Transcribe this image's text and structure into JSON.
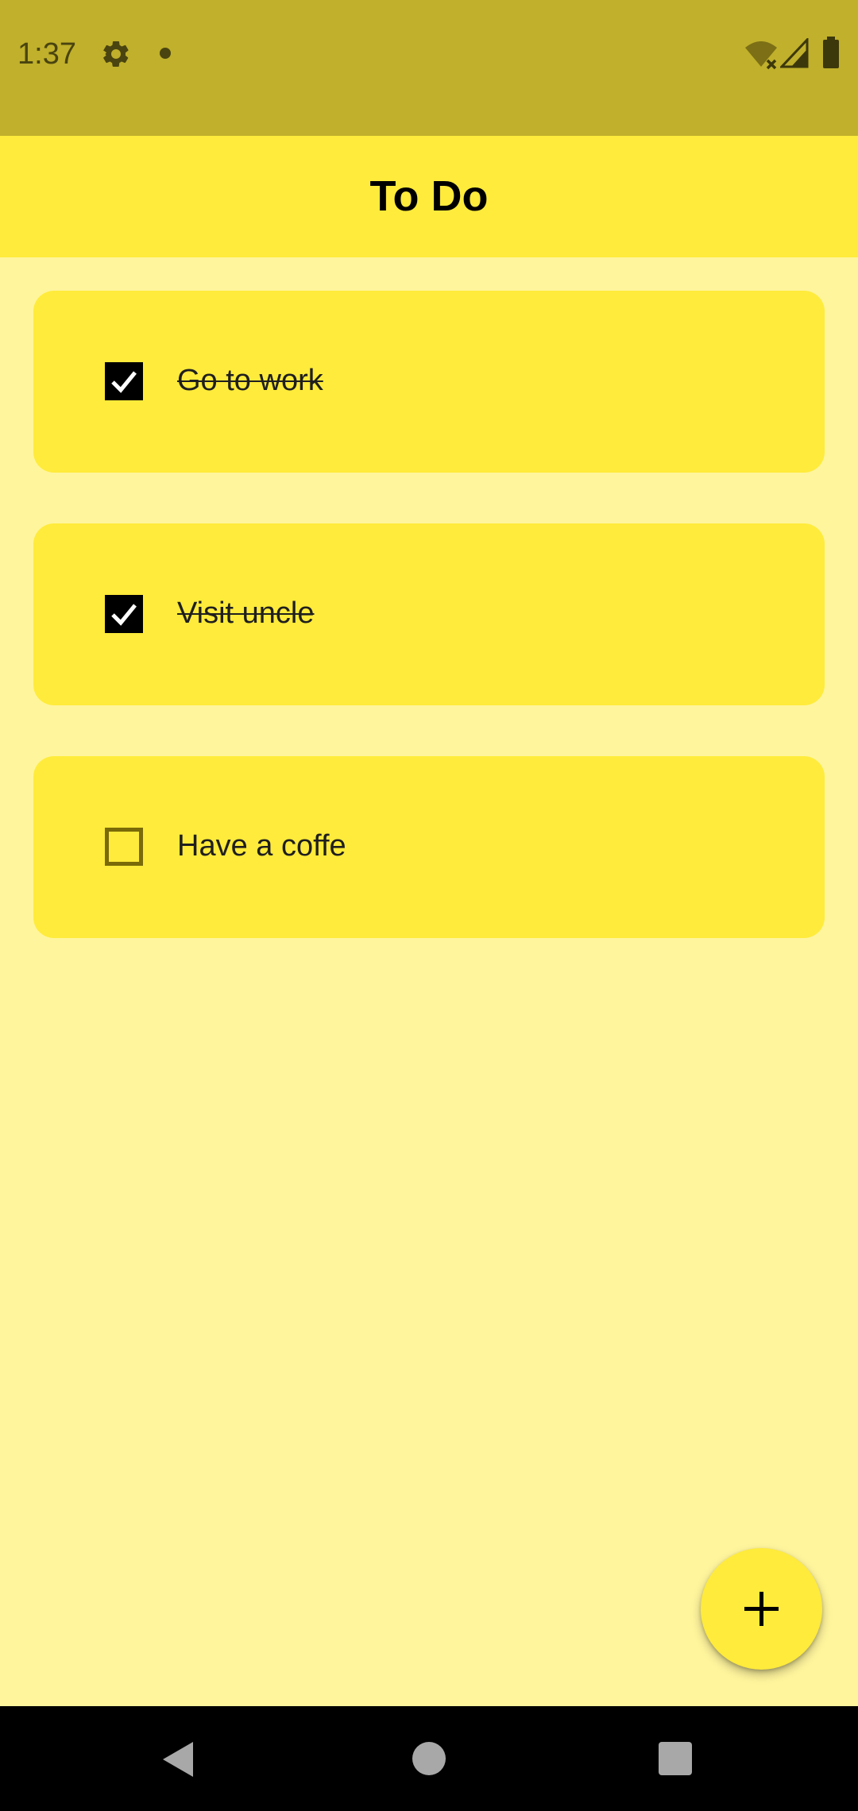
{
  "status_bar": {
    "time": "1:37",
    "icons": [
      "gear-icon",
      "notification-dot-icon",
      "wifi-off-icon",
      "cell-signal-icon",
      "battery-icon"
    ]
  },
  "app_bar": {
    "title": "To Do"
  },
  "todos": [
    {
      "label": "Go to work",
      "checked": true
    },
    {
      "label": "Visit uncle",
      "checked": true
    },
    {
      "label": "Have a coffe",
      "checked": false
    }
  ],
  "fab": {
    "icon": "plus-icon"
  },
  "nav_bar": {
    "icons": [
      "back-icon",
      "home-icon",
      "recents-icon"
    ]
  },
  "colors": {
    "status_bar": "#c0b02b",
    "app_bar": "#ffeb3b",
    "background": "#fff59d",
    "card": "#ffeb3b",
    "nav_bar": "#000000"
  }
}
